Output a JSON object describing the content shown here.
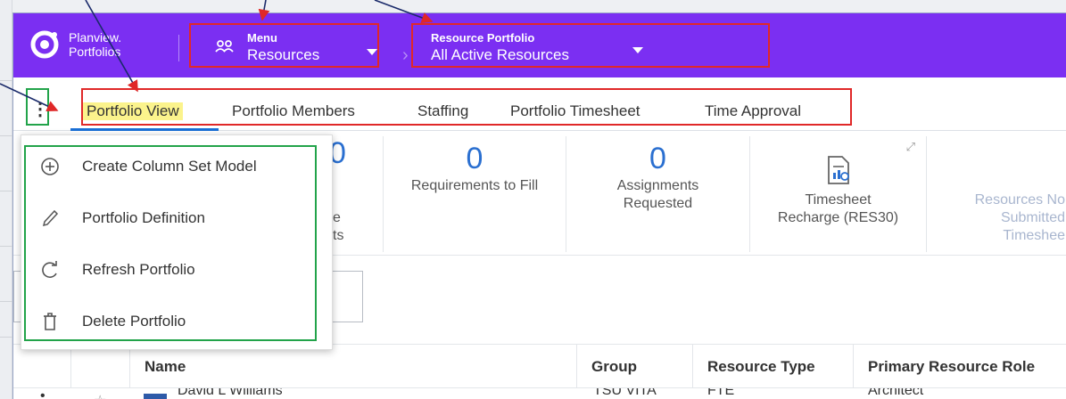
{
  "brand": {
    "line1": "Planview.",
    "line2": "Portfolios",
    "accent": "#7b2ff2"
  },
  "header": {
    "menu_dropdown": {
      "small_label": "Menu",
      "value": "Resources",
      "icon": "people-icon"
    },
    "portfolio_dropdown": {
      "small_label": "Resource Portfolio",
      "value": "All Active Resources"
    }
  },
  "tabs": [
    {
      "label": "Portfolio View",
      "active": true
    },
    {
      "label": "Portfolio Members",
      "active": false
    },
    {
      "label": "Staffing",
      "active": false
    },
    {
      "label": "Portfolio Timesheet",
      "active": false
    },
    {
      "label": "Time Approval",
      "active": false
    }
  ],
  "kebab_label": "⋮",
  "tiles": [
    {
      "num": "0",
      "line1": "e",
      "line2": "ts"
    },
    {
      "num": "0",
      "line1": "Requirements to Fill",
      "line2": ""
    },
    {
      "num": "0",
      "line1": "Assignments",
      "line2": "Requested"
    },
    {
      "num": "",
      "line1": "Timesheet",
      "line2": "Recharge (RES30)"
    },
    {
      "num": "",
      "line1": "Resources No",
      "line2": "Submitted",
      "line3": "Timeshee"
    }
  ],
  "menu_items": [
    {
      "label": "Create Column Set Model",
      "icon": "plus-circle-icon"
    },
    {
      "label": "Portfolio Definition",
      "icon": "pencil-icon"
    },
    {
      "label": "Refresh Portfolio",
      "icon": "refresh-icon"
    },
    {
      "label": "Delete Portfolio",
      "icon": "trash-icon"
    }
  ],
  "table": {
    "columns": [
      "Name",
      "Group",
      "Resource Type",
      "Primary Resource Role"
    ],
    "row": {
      "name": "David L Williams",
      "group": "TSU VITA",
      "type": "FTE",
      "role": "Architect"
    }
  },
  "colors": {
    "annotation_red": "#e02828",
    "annotation_green": "#22a34a",
    "link_blue": "#1a6fd6"
  }
}
